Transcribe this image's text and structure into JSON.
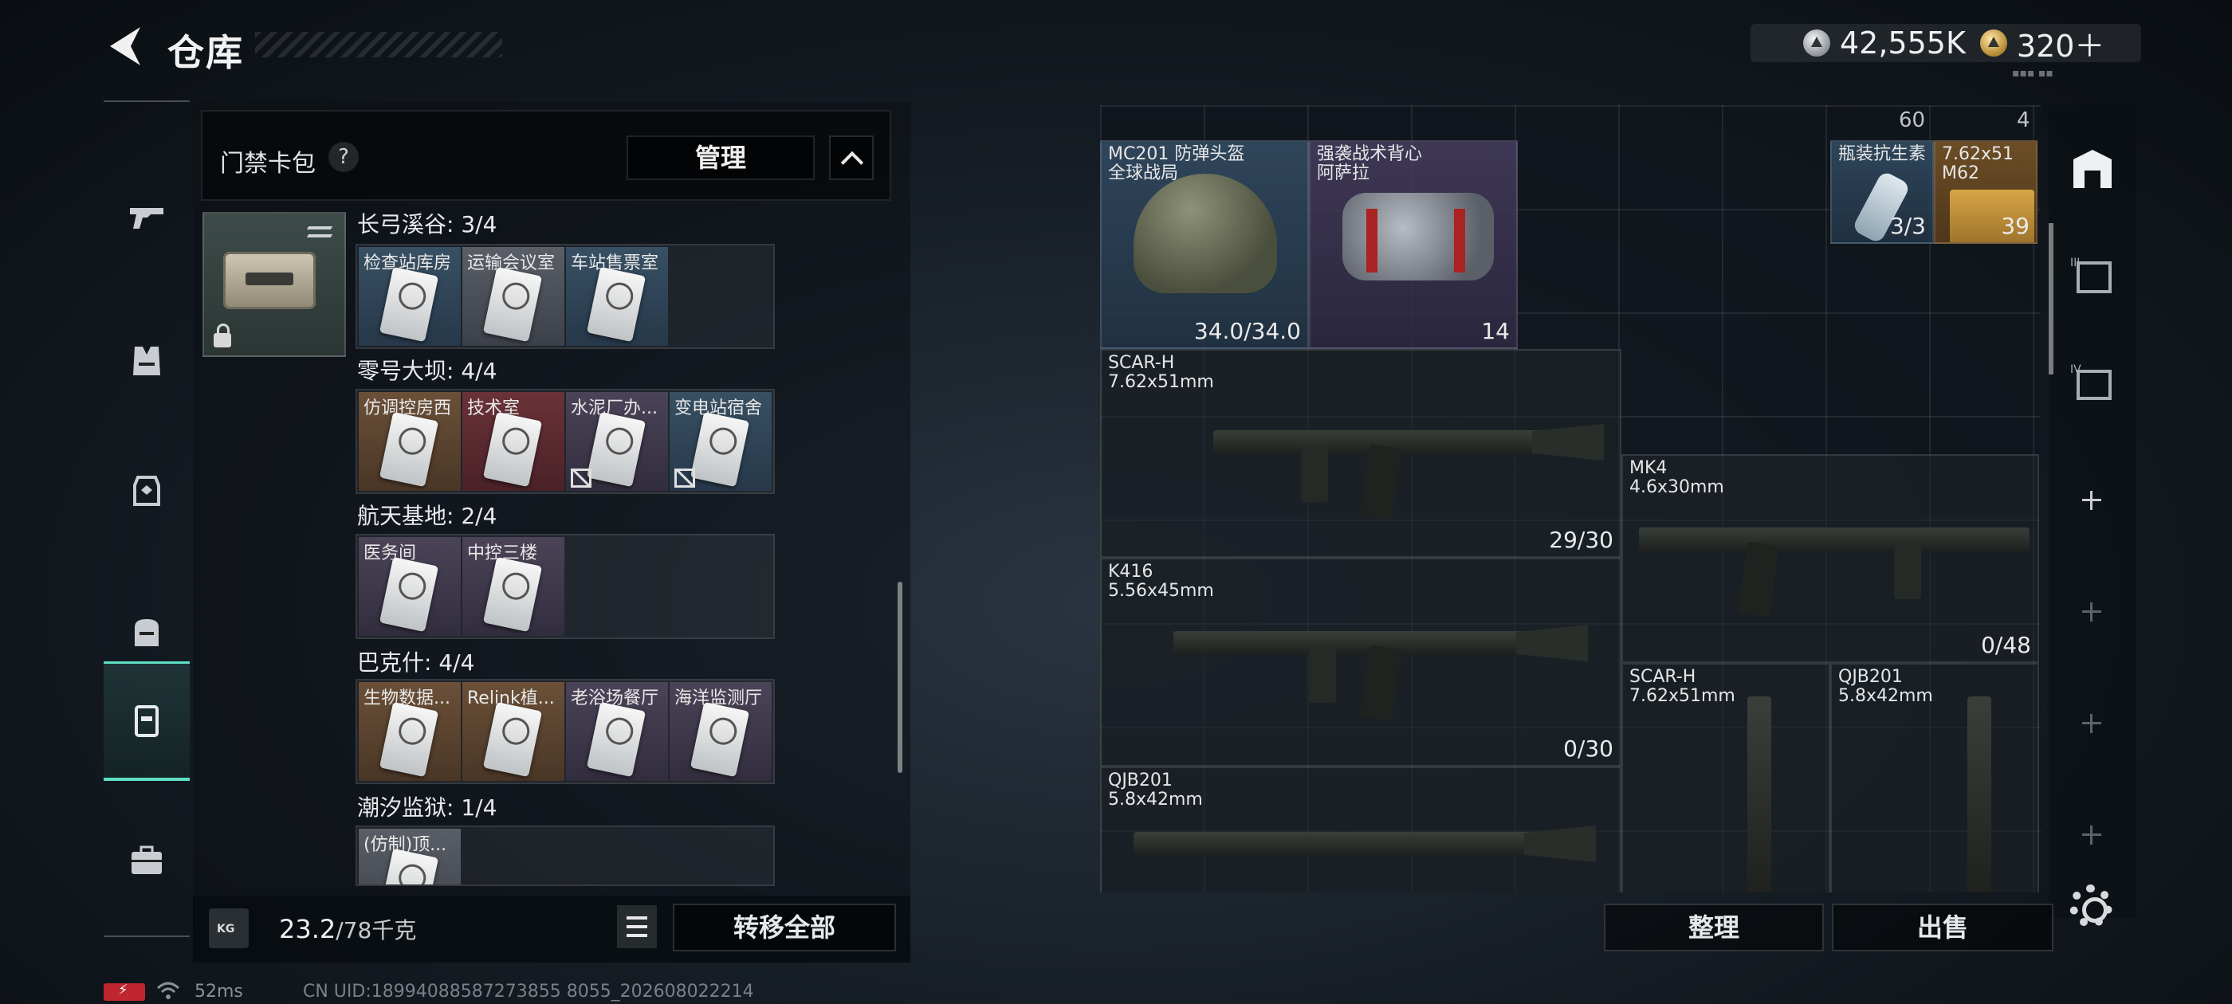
{
  "header": {
    "title": "仓库",
    "currency": [
      {
        "icon": "silver-coin-icon",
        "value": "42,555K"
      },
      {
        "icon": "gold-coin-icon",
        "value": "320＋"
      }
    ]
  },
  "left_nav": [
    {
      "icon": "gun-icon",
      "active": false
    },
    {
      "icon": "vest-icon",
      "active": false
    },
    {
      "icon": "backpack-icon",
      "active": false
    },
    {
      "icon": "bag-icon",
      "active": false
    },
    {
      "icon": "keycard-icon",
      "active": true
    },
    {
      "icon": "briefcase-icon",
      "active": false
    }
  ],
  "keycard_panel": {
    "label": "门禁卡包",
    "help": "?",
    "manage": "管理",
    "groups": [
      {
        "title": "长弓溪谷: 3/4",
        "cards": [
          {
            "label": "检查站库房",
            "rarity": "blue"
          },
          {
            "label": "运输会议室",
            "rarity": "white"
          },
          {
            "label": "车站售票室",
            "rarity": "blue"
          },
          {
            "label": "",
            "rarity": "empty"
          }
        ]
      },
      {
        "title": "零号大坝: 4/4",
        "cards": [
          {
            "label": "仿调控房西",
            "rarity": "brown"
          },
          {
            "label": "技术室",
            "rarity": "red"
          },
          {
            "label": "水泥厂办...",
            "rarity": "purple"
          },
          {
            "label": "变电站宿舍",
            "rarity": "blue"
          }
        ]
      },
      {
        "title": "航天基地: 2/4",
        "cards": [
          {
            "label": "医务间",
            "rarity": "purple"
          },
          {
            "label": "中控三楼",
            "rarity": "purple"
          },
          {
            "label": "",
            "rarity": "empty"
          },
          {
            "label": "",
            "rarity": "empty"
          }
        ]
      },
      {
        "title": "巴克什: 4/4",
        "cards": [
          {
            "label": "生物数据...",
            "rarity": "brown"
          },
          {
            "label": "Relink植...",
            "rarity": "brown"
          },
          {
            "label": "老浴场餐厅",
            "rarity": "purple"
          },
          {
            "label": "海洋监测厅",
            "rarity": "purple"
          }
        ]
      },
      {
        "title": "潮汐监狱: 1/4",
        "cards": [
          {
            "label": "(仿制)顶...",
            "rarity": "white"
          },
          {
            "label": "",
            "rarity": "empty"
          },
          {
            "label": "",
            "rarity": "empty"
          },
          {
            "label": "",
            "rarity": "empty"
          }
        ]
      }
    ]
  },
  "footer": {
    "weight_current": "23.2",
    "weight_max": "/78千克",
    "transfer_all": "转移全部",
    "sort": "整理",
    "sell": "出售"
  },
  "status": {
    "ping": "52ms",
    "uid": "CN UID:18994088587273855 8055_202608022214"
  },
  "storage": {
    "top_counts": [
      "60",
      "4"
    ],
    "items": {
      "helmet": {
        "name": "MC201 防弹头盔\n全球战局",
        "durability": "34.0/34.0"
      },
      "vest": {
        "name": "强袭战术背心\n阿萨拉",
        "count": "14"
      },
      "antibiotic": {
        "name": "瓶装抗生素",
        "uses": "3/3"
      },
      "ammo": {
        "name": "7.62x51\nM62",
        "count": "39"
      },
      "scar1": {
        "name": "SCAR-H\n7.62x51mm",
        "ammo": "29/30"
      },
      "mk4": {
        "name": "MK4\n4.6x30mm",
        "ammo": "0/48"
      },
      "k416": {
        "name": "K416\n5.56x45mm",
        "ammo": "0/30"
      },
      "scar2": {
        "name": "SCAR-H\n7.62x51mm"
      },
      "qjb1": {
        "name": "QJB201\n5.8x42mm"
      },
      "qjb2": {
        "name": "QJB201\n5.8x42mm"
      }
    }
  },
  "right_nav": [
    "storage-main-icon",
    "storage-tab-3-icon",
    "storage-tab-4-icon",
    "add-tab-icon"
  ]
}
